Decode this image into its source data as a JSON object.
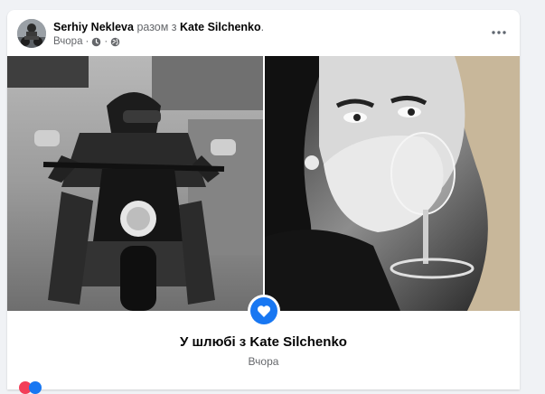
{
  "post": {
    "author": "Serhiy Nekleva",
    "with_text": "разом з",
    "tagged": "Kate Silchenko",
    "period": ".",
    "time": "Вчора",
    "separator": "·",
    "icons": [
      "time-icon",
      "public-globe-icon",
      "more-options-icon"
    ]
  },
  "life_event": {
    "icon": "heart-icon",
    "title": "У шлюбі з Kate Silchenko",
    "date": "Вчора"
  },
  "colors": {
    "accent": "#1877f2",
    "page_background": "#f0f2f5",
    "card_background": "#ffffff",
    "text_primary": "#050505",
    "text_secondary": "#65676b"
  }
}
